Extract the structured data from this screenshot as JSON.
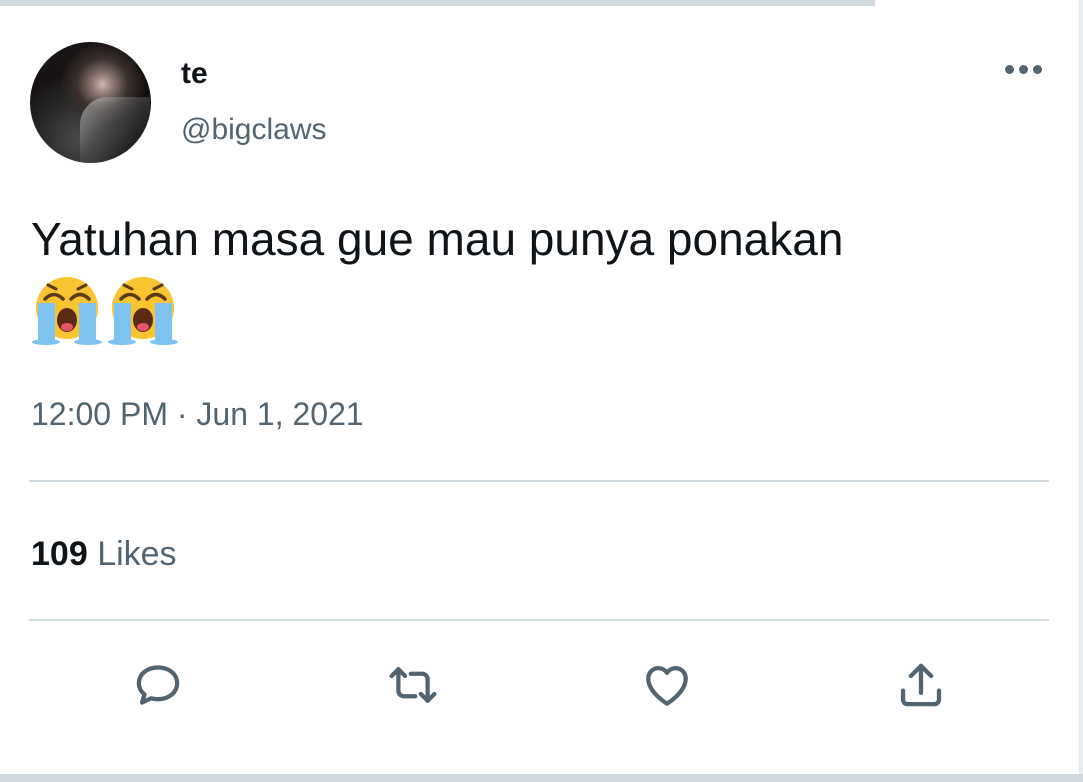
{
  "tweet": {
    "author": {
      "display_name": "te",
      "handle": "@bigclaws"
    },
    "text": "Yatuhan masa gue mau punya ponakan",
    "emojis": [
      "loudly-crying-face",
      "loudly-crying-face"
    ],
    "time": "12:00 PM",
    "separator": "·",
    "date": "Jun 1, 2021",
    "likes": {
      "count": "109",
      "label": "Likes"
    }
  },
  "actions": [
    {
      "name": "reply",
      "icon": "speech-bubble-icon"
    },
    {
      "name": "retweet",
      "icon": "retweet-arrows-icon"
    },
    {
      "name": "like",
      "icon": "heart-icon"
    },
    {
      "name": "share",
      "icon": "share-upload-icon"
    }
  ],
  "colors": {
    "text_primary": "#0f1419",
    "text_secondary": "#536471",
    "divider": "#d0d9de",
    "background": "#ffffff"
  }
}
